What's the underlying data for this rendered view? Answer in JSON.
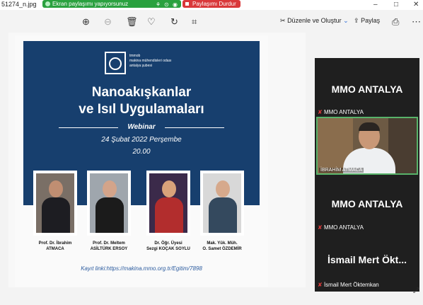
{
  "window": {
    "file_name": "51274_n.jpg",
    "share_status": "Ekran paylaşımı yapıyorsunuz",
    "stop_share_label": "Paylaşımı Durdur",
    "controls": {
      "minimize": "–",
      "maximize": "□",
      "close": "✕"
    }
  },
  "toolbar": {
    "icons": [
      "zoom-in-icon",
      "zoom-out-icon",
      "trash-icon",
      "heart-icon",
      "rotate-icon",
      "crop-icon"
    ],
    "edit_label": "Düzenle ve Oluştur",
    "share_label": "Paylaş"
  },
  "poster": {
    "org_lines": [
      "tmmob",
      "makina mühendisleri odası",
      "antalya şubesi"
    ],
    "title_line1": "Nanoakışkanlar",
    "title_line2": "ve Isıl Uygulamaları",
    "event_type": "Webinar",
    "date": "24 Şubat 2022 Perşembe",
    "time": "20.00",
    "speakers": [
      {
        "title": "Prof. Dr. İbrahim",
        "name": "ATMACA"
      },
      {
        "title": "Prof. Dr. Meltem",
        "name": "ASİLTÜRK ERSOY"
      },
      {
        "title": "Dr. Öğr. Üyesi",
        "name": "Sezgi KOÇAK SOYLU"
      },
      {
        "title": "Mak. Yük. Müh.",
        "name": "O. Samet ÖZDEMİR"
      }
    ],
    "registration": "Kayıt linki:https://makina.mmo.org.tr/Egitim/7898"
  },
  "participants": {
    "tile1_name": "MMO ANTALYA",
    "tile1_label": "MMO ANTALYA",
    "video_label": "İBRAHİM ATMACA",
    "tile3_name": "MMO ANTALYA",
    "tile3_label": "MMO ANTALYA",
    "tile4_name": "İsmail Mert Ökt...",
    "tile4_label": "İsmail Mert Öktemkan"
  },
  "colors": {
    "poster_blue": "#173f6e",
    "share_green": "#2aa13f",
    "stop_red": "#d9383a",
    "active_speaker_border": "#58b36a"
  }
}
